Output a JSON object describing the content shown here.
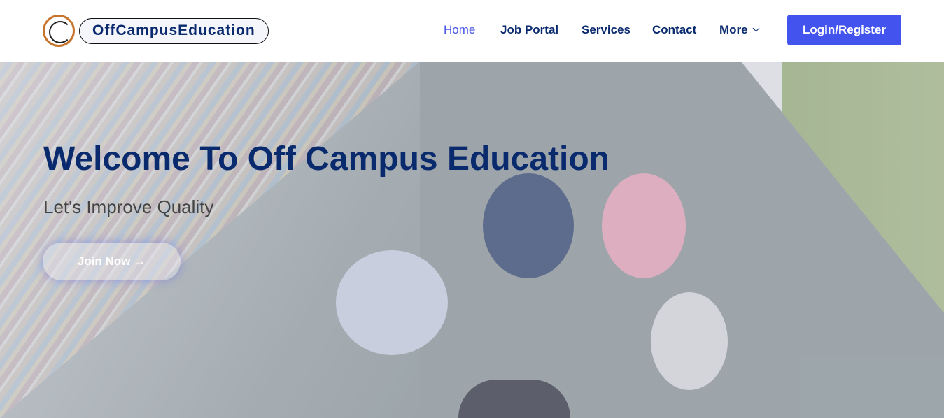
{
  "header": {
    "brand": "OffCampusEducation",
    "nav": [
      "Home",
      "Job Portal",
      "Services",
      "Contact",
      "More"
    ],
    "login": "Login/Register"
  },
  "hero": {
    "title": "Welcome To Off Campus Education",
    "subtitle": "Let's Improve Quality",
    "join": "Join Now",
    "join_arrow": "→"
  }
}
